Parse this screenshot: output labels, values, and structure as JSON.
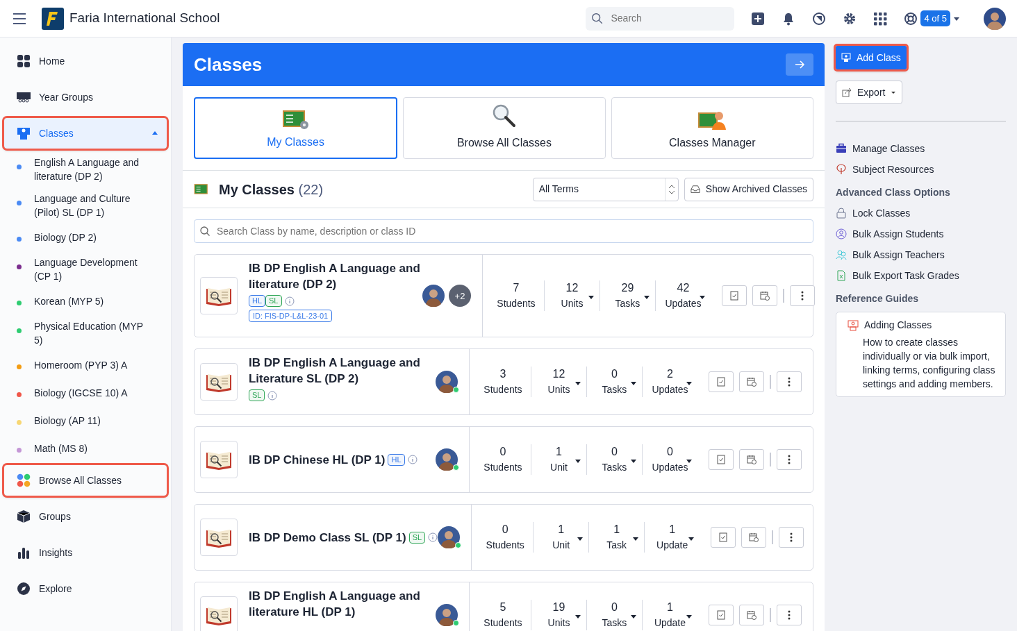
{
  "topbar": {
    "brand": "Faria International School",
    "search_placeholder": "Search",
    "seats_badge": "4 of 5"
  },
  "sidebar": {
    "items": [
      {
        "label": "Home",
        "selected": false,
        "highlighted": false
      },
      {
        "label": "Year Groups",
        "selected": false,
        "highlighted": false
      },
      {
        "label": "Classes",
        "selected": true,
        "highlighted": true,
        "expanded": true,
        "children": [
          {
            "label": "English A Language and literature (DP 2)",
            "color": "#4a8af4"
          },
          {
            "label": "Language and Culture (Pilot) SL (DP 1)",
            "color": "#4a8af4"
          },
          {
            "label": "Biology (DP 2)",
            "color": "#4a8af4"
          },
          {
            "label": "Language Development (CP 1)",
            "color": "#7b2d8e"
          },
          {
            "label": "Korean (MYP 5)",
            "color": "#2ecc71"
          },
          {
            "label": "Physical Education (MYP 5)",
            "color": "#2ecc71"
          },
          {
            "label": "Homeroom (PYP 3) A",
            "color": "#f39c12"
          },
          {
            "label": "Biology (IGCSE 10) A",
            "color": "#f0574a"
          },
          {
            "label": "Biology (AP 11)",
            "color": "#f7d774"
          },
          {
            "label": "Math (MS 8)",
            "color": "#c497d6"
          }
        ]
      },
      {
        "label": "Browse All Classes",
        "selected": false,
        "highlighted": true
      },
      {
        "label": "Groups",
        "selected": false,
        "highlighted": false
      },
      {
        "label": "Insights",
        "selected": false,
        "highlighted": false
      },
      {
        "label": "Explore",
        "selected": false,
        "highlighted": false
      }
    ]
  },
  "main": {
    "title": "Classes",
    "tabs": [
      {
        "label": "My Classes",
        "selected": true
      },
      {
        "label": "Browse All Classes",
        "selected": false
      },
      {
        "label": "Classes Manager",
        "selected": false
      }
    ],
    "section_title": "My Classes",
    "section_count": "(22)",
    "term_select": "All Terms",
    "archived_button": "Show Archived Classes",
    "search_placeholder": "Search Class by name, description or class ID",
    "classes": [
      {
        "name": "IB DP English A Language and literature (DP 2)",
        "tags": [
          {
            "label": "HL",
            "color": "#3b7be8"
          },
          {
            "label": "SL",
            "color": "#2fa657"
          }
        ],
        "class_id": "ID: FIS-DP-L&L-23-01",
        "online": false,
        "extra_teachers": "+2",
        "stats": [
          {
            "value": "7",
            "label": "Students",
            "caret": false
          },
          {
            "value": "12",
            "label": "Units",
            "caret": true
          },
          {
            "value": "29",
            "label": "Tasks",
            "caret": true
          },
          {
            "value": "42",
            "label": "Updates",
            "caret": true
          }
        ]
      },
      {
        "name": "IB DP English A Language and Literature SL (DP 2)",
        "tags": [
          {
            "label": "SL",
            "color": "#2fa657"
          }
        ],
        "online": true,
        "stats": [
          {
            "value": "3",
            "label": "Students",
            "caret": false
          },
          {
            "value": "12",
            "label": "Units",
            "caret": true
          },
          {
            "value": "0",
            "label": "Tasks",
            "caret": true
          },
          {
            "value": "2",
            "label": "Updates",
            "caret": true
          }
        ]
      },
      {
        "name": "IB DP Chinese HL (DP 1)",
        "tags": [
          {
            "label": "HL",
            "color": "#3b7be8"
          }
        ],
        "online": true,
        "stats": [
          {
            "value": "0",
            "label": "Students",
            "caret": false
          },
          {
            "value": "1",
            "label": "Unit",
            "caret": true
          },
          {
            "value": "0",
            "label": "Tasks",
            "caret": true
          },
          {
            "value": "0",
            "label": "Updates",
            "caret": true
          }
        ]
      },
      {
        "name": "IB DP Demo Class SL (DP 1)",
        "tags": [
          {
            "label": "SL",
            "color": "#2fa657"
          }
        ],
        "online": true,
        "stats": [
          {
            "value": "0",
            "label": "Students",
            "caret": false
          },
          {
            "value": "1",
            "label": "Unit",
            "caret": true
          },
          {
            "value": "1",
            "label": "Task",
            "caret": true
          },
          {
            "value": "1",
            "label": "Update",
            "caret": true
          }
        ]
      },
      {
        "name": "IB DP English A Language and literature HL (DP 1)",
        "online": true,
        "stats": [
          {
            "value": "5",
            "label": "Students",
            "caret": false
          },
          {
            "value": "19",
            "label": "Units",
            "caret": true
          },
          {
            "value": "0",
            "label": "Tasks",
            "caret": true
          },
          {
            "value": "1",
            "label": "Update",
            "caret": true
          }
        ]
      }
    ]
  },
  "aside": {
    "add_button": {
      "label": "Add Class",
      "highlighted": true
    },
    "export_button": "Export",
    "links": [
      {
        "label": "Manage Classes"
      },
      {
        "label": "Subject Resources"
      }
    ],
    "advanced_heading": "Advanced Class Options",
    "advanced_links": [
      {
        "label": "Lock Classes"
      },
      {
        "label": "Bulk Assign Students"
      },
      {
        "label": "Bulk Assign Teachers"
      },
      {
        "label": "Bulk Export Task Grades"
      }
    ],
    "guides_heading": "Reference Guides",
    "guide": {
      "title": "Adding Classes",
      "text": "How to create classes individually or via bulk import, linking terms, configuring class settings and adding members."
    }
  }
}
